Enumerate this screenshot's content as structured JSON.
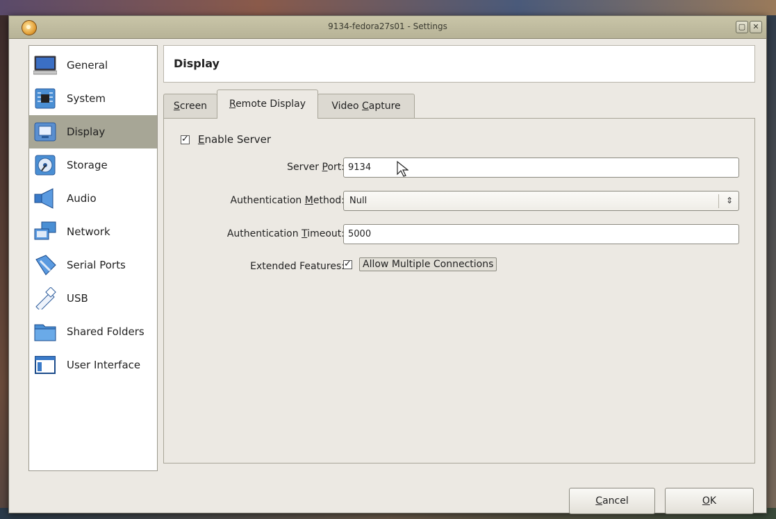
{
  "window": {
    "title": "9134-fedora27s01 - Settings",
    "maximize_glyph": "▢",
    "close_glyph": "✕"
  },
  "sidebar": {
    "items": [
      {
        "label": "General",
        "icon": "monitor-icon",
        "selected": false
      },
      {
        "label": "System",
        "icon": "chip-icon",
        "selected": false
      },
      {
        "label": "Display",
        "icon": "display-icon",
        "selected": true
      },
      {
        "label": "Storage",
        "icon": "disk-icon",
        "selected": false
      },
      {
        "label": "Audio",
        "icon": "speaker-icon",
        "selected": false
      },
      {
        "label": "Network",
        "icon": "network-icon",
        "selected": false
      },
      {
        "label": "Serial Ports",
        "icon": "serial-port-icon",
        "selected": false
      },
      {
        "label": "USB",
        "icon": "usb-icon",
        "selected": false
      },
      {
        "label": "Shared Folders",
        "icon": "folder-icon",
        "selected": false
      },
      {
        "label": "User Interface",
        "icon": "window-icon",
        "selected": false
      }
    ]
  },
  "header": {
    "title": "Display"
  },
  "tabs": {
    "screen": {
      "pre": "",
      "mnemonic": "S",
      "post": "creen",
      "active": false
    },
    "remote_display": {
      "pre": "",
      "mnemonic": "R",
      "post": "emote Display",
      "active": true
    },
    "video_capture": {
      "pre": "Video ",
      "mnemonic": "C",
      "post": "apture",
      "active": false
    }
  },
  "remote_display": {
    "enable_server": {
      "checked": true,
      "pre": "",
      "mnemonic": "E",
      "post": "nable Server"
    },
    "server_port": {
      "label_pre": "Server ",
      "label_mnemonic": "P",
      "label_post": "ort:",
      "value": "9134"
    },
    "auth_method": {
      "label_pre": "Authentication ",
      "label_mnemonic": "M",
      "label_post": "ethod:",
      "value": "Null"
    },
    "auth_timeout": {
      "label_pre": "Authentication ",
      "label_mnemonic": "T",
      "label_post": "imeout:",
      "value": "5000"
    },
    "extended_features": {
      "label": "Extended Features:",
      "checked": true,
      "option": "Allow Multiple Connections"
    }
  },
  "buttons": {
    "cancel": {
      "pre": "",
      "mnemonic": "C",
      "post": "ancel"
    },
    "ok": {
      "pre": "",
      "mnemonic": "O",
      "post": "K"
    }
  },
  "colors": {
    "titlebar": "#c3bfa3",
    "selected_item": "#a7a696",
    "window_bg": "#ece9e3"
  }
}
